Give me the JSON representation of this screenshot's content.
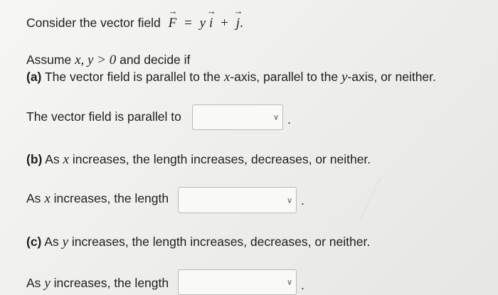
{
  "intro": {
    "text": "Consider the vector field",
    "F": "F",
    "equals": "=",
    "y": "y",
    "i": "i",
    "plus": "+",
    "j": "j",
    "period": "."
  },
  "assume": {
    "text": "Assume",
    "math": "x, y > 0",
    "tail": "and decide if"
  },
  "part_a": {
    "label": "(a)",
    "text_before": "The vector field is parallel to the",
    "x": "x",
    "mid": "-axis, parallel to the",
    "y": "y",
    "end": "-axis, or neither.",
    "answer_prompt": "The vector field is parallel to",
    "select_value": ""
  },
  "part_b": {
    "label": "(b)",
    "text_before": "As",
    "x": "x",
    "text_after": "increases, the length increases, decreases, or neither.",
    "answer_before": "As",
    "answer_var": "x",
    "answer_after": "increases, the length",
    "select_value": ""
  },
  "part_c": {
    "label": "(c)",
    "text_before": "As",
    "y": "y",
    "text_after": "increases, the length increases, decreases, or neither.",
    "answer_before": "As",
    "answer_var": "y",
    "answer_after": "increases, the length",
    "select_value": ""
  },
  "icons": {
    "dropdown": "chevron-down-icon"
  },
  "period": "."
}
